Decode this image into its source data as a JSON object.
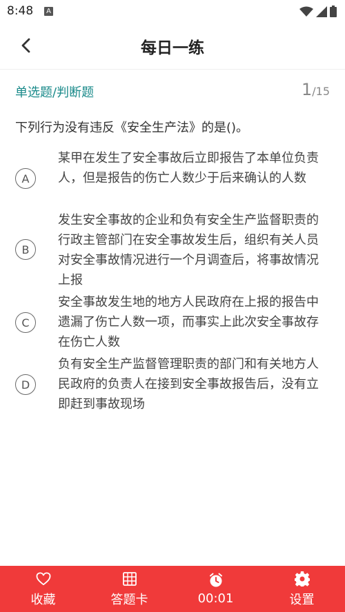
{
  "status_bar": {
    "time": "8:48",
    "notif_icon": "A"
  },
  "header": {
    "title": "每日一练"
  },
  "question": {
    "type": "单选题/判断题",
    "current": "1",
    "total": "/15",
    "text": "下列行为没有违反《安全生产法》的是()。",
    "options": [
      {
        "letter": "A",
        "text": "某甲在发生了安全事故后立即报告了本单位负责人，但是报告的伤亡人数少于后来确认的人数"
      },
      {
        "letter": "B",
        "text": "发生安全事故的企业和负有安全生产监督职责的行政主管部门在安全事故发生后，组织有关人员对安全事故情况进行一个月调查后，将事故情况上报"
      },
      {
        "letter": "C",
        "text": "安全事故发生地的地方人民政府在上报的报告中遗漏了伤亡人数一项，而事实上此次安全事故存在伤亡人数"
      },
      {
        "letter": "D",
        "text": "负有安全生产监督管理职责的部门和有关地方人民政府的负责人在接到安全事故报告后，没有立即赶到事故现场"
      }
    ]
  },
  "bottom_bar": {
    "favorite": "收藏",
    "answer_card": "答题卡",
    "timer": "00:01",
    "settings": "设置"
  },
  "colors": {
    "accent": "#f03a3a",
    "type_label": "#1a8a8a"
  }
}
